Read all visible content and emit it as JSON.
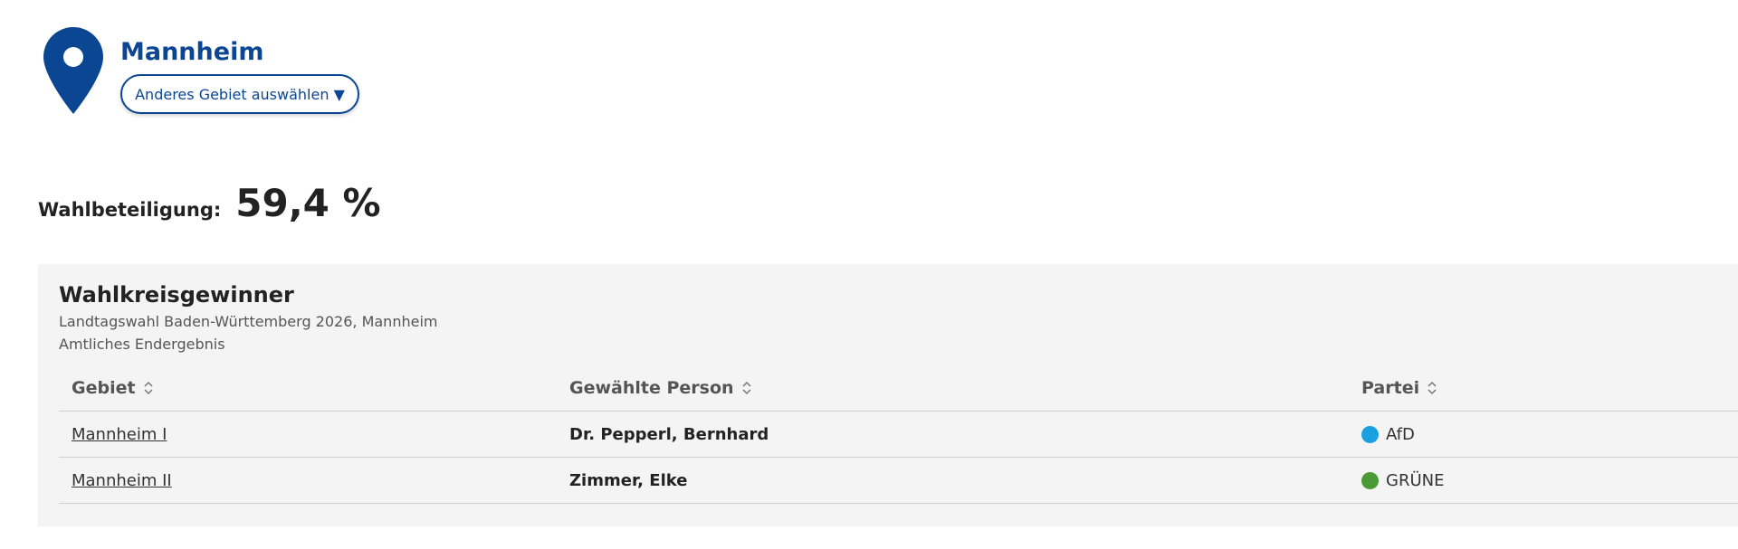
{
  "location": {
    "title": "Mannheim",
    "change_button_label": "Anderes Gebiet auswählen ▼",
    "pin_icon": "map-pin-icon",
    "brand_color": "#0b4693"
  },
  "turnout": {
    "label": "Wahlbeteiligung:",
    "value": "59,4 %"
  },
  "winners": {
    "title": "Wahlkreisgewinner",
    "subtitle": "Landtagswahl Baden-Württemberg 2026, Mannheim",
    "status": "Amtliches Endergebnis",
    "columns": [
      "Gebiet",
      "Gewählte Person",
      "Partei"
    ],
    "rows": [
      {
        "area": "Mannheim I",
        "person": "Dr. Pepperl, Bernhard",
        "party": "AfD",
        "party_color": "#1a9fe0"
      },
      {
        "area": "Mannheim II",
        "person": "Zimmer, Elke",
        "party": "GRÜNE",
        "party_color": "#4a9a35"
      }
    ]
  }
}
